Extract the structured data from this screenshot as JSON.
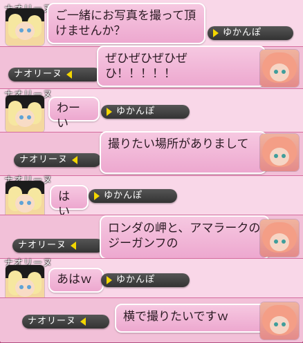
{
  "partner_name": "ナオリーヌ",
  "player_name": "ゆかんぽ",
  "messages": [
    {
      "speaker": "player",
      "label": "ナオリーヌ",
      "text": "ご一緒にお写真を撮って頂けませんか？",
      "tag": "ゆかんぽ"
    },
    {
      "speaker": "partner",
      "label": "ナオリーヌ",
      "text": "ぜひぜひぜひぜひ！！！！！",
      "tag": "ナオリーヌ"
    },
    {
      "speaker": "player",
      "label": "ナオリーヌ",
      "text": "わーい",
      "tag": "ゆかんぽ"
    },
    {
      "speaker": "partner",
      "label": "ナオリーヌ",
      "text": "撮りたい場所がありまして",
      "tag": "ナオリーヌ"
    },
    {
      "speaker": "player",
      "label": "ナオリーヌ",
      "text": "はい",
      "tag": "ゆかんぽ"
    },
    {
      "speaker": "partner",
      "label": "ナオリーヌ",
      "text": "ロンダの岬と、アマラークのジーガンフの",
      "tag": "ナオリーヌ"
    },
    {
      "speaker": "player",
      "label": "ナオリーヌ",
      "text": "あはｗ",
      "tag": "ゆかんぽ"
    },
    {
      "speaker": "partner",
      "label": "ナオリーヌ",
      "text": "横で撮りたいですｗ",
      "tag": "ナオリーヌ"
    }
  ]
}
